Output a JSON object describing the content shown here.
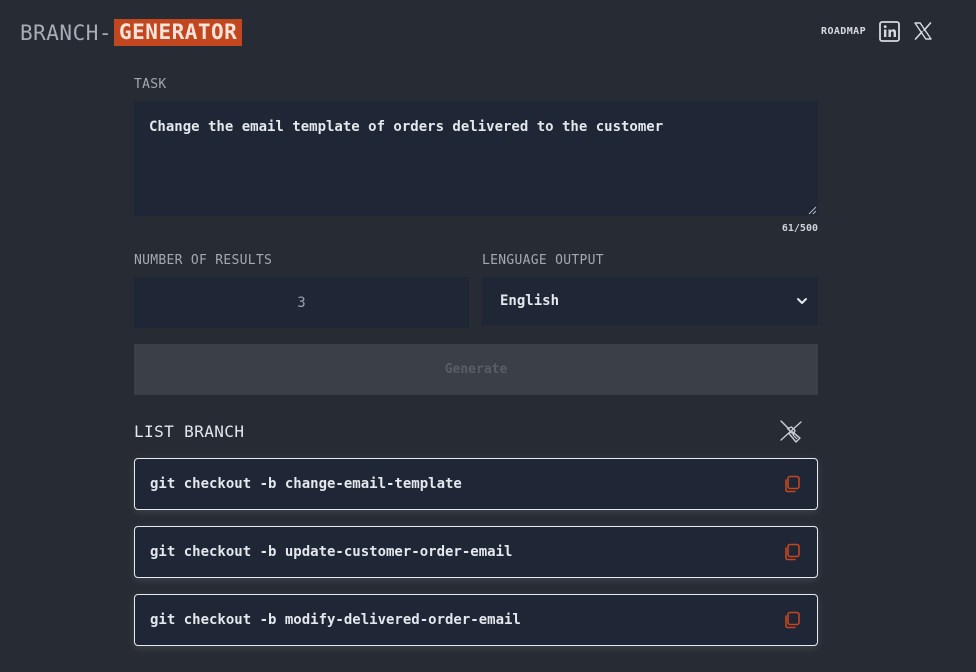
{
  "header": {
    "logo_part1": "BRANCH-",
    "logo_part2": "GENERATOR",
    "roadmap_label": "ROADMAP",
    "icons": [
      "linkedin-icon",
      "x-twitter-icon"
    ]
  },
  "form": {
    "task_label": "TASK",
    "task_value": "Change the email template of orders delivered to the customer",
    "char_counter": "61/500",
    "num_results_label": "NUMBER OF RESULTS",
    "num_results_value": "3",
    "language_label": "LENGUAGE OUTPUT",
    "language_value": "English",
    "generate_label": "Generate"
  },
  "list": {
    "title": "LIST BRANCH",
    "items": [
      {
        "command": "git checkout -b change-email-template"
      },
      {
        "command": "git checkout -b update-customer-order-email"
      },
      {
        "command": "git checkout -b modify-delivered-order-email"
      }
    ]
  },
  "colors": {
    "background": "#272b33",
    "panel": "#1f2736",
    "accent": "#c2461e",
    "disabled_button": "#3a3f48"
  }
}
